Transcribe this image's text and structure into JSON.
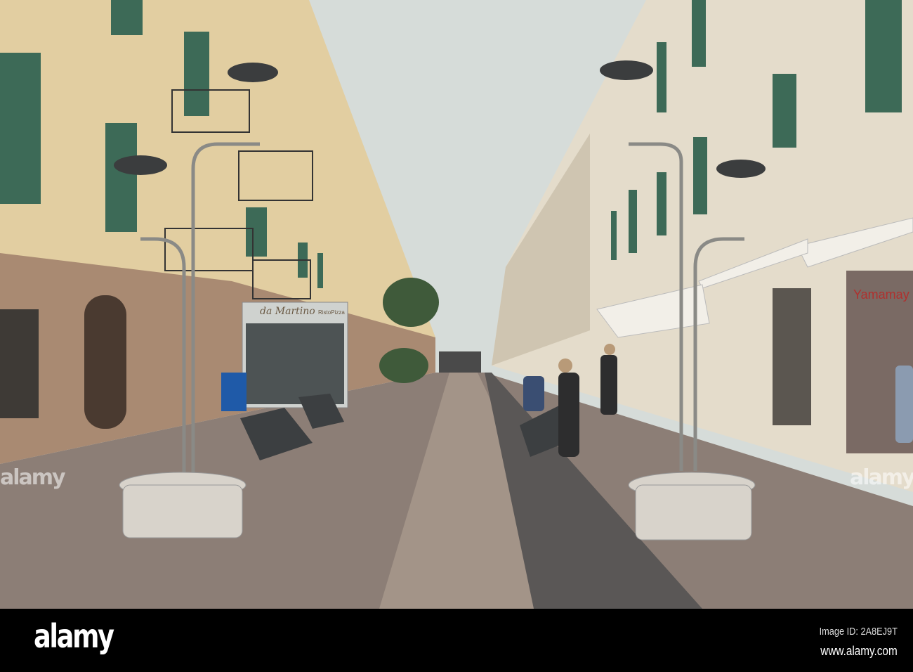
{
  "photo": {
    "signs": {
      "restaurant_name": "da Martino",
      "restaurant_sub": "RistoPizza",
      "shop_name": "Yamamay"
    }
  },
  "watermarks": [
    "alamy",
    "alamy",
    "alamy"
  ],
  "footer": {
    "logo": "alamy",
    "image_id": "Image ID: 2A8EJ9T",
    "url": "www.alamy.com"
  },
  "colors": {
    "sky": "#d6dcd9",
    "left_facade": "#e6d3a8",
    "right_facade": "#e4dccb",
    "shutter": "#3d6a57",
    "footer": "#000000"
  }
}
